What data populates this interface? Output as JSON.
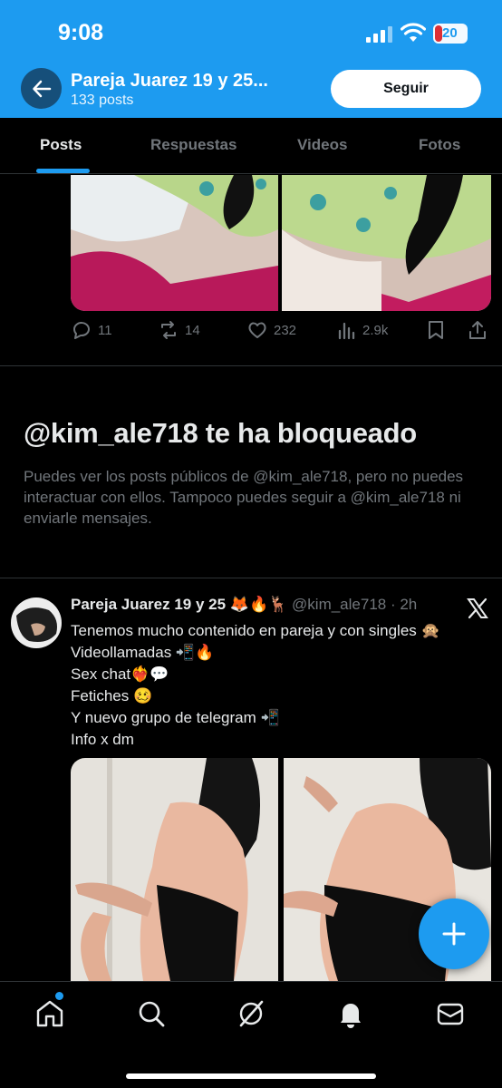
{
  "status_bar": {
    "time": "9:08",
    "battery": "20"
  },
  "header": {
    "profile_name": "Pareja Juarez 19 y 25...",
    "posts_count": "133 posts",
    "follow_label": "Seguir"
  },
  "tabs": [
    {
      "label": "Posts",
      "active": true
    },
    {
      "label": "Respuestas",
      "active": false
    },
    {
      "label": "Videos",
      "active": false
    },
    {
      "label": "Fotos",
      "active": false
    }
  ],
  "previous_post": {
    "replies": "11",
    "reposts": "14",
    "likes": "232",
    "views": "2.9k"
  },
  "blocked": {
    "title": "@kim_ale718 te ha bloqueado",
    "description": "Puedes ver los posts públicos de @kim_ale718, pero no puedes interactuar con ellos. Tampoco puedes seguir a @kim_ale718 ni enviarle mensajes."
  },
  "post": {
    "author": "Pareja Juarez 19 y 25 🦊🔥🦌",
    "handle_time": "@kim_ale718 · 2h",
    "lines": [
      "Tenemos mucho contenido en pareja y con singles 🙊",
      "Videollamadas 📲🔥",
      "Sex chat❤️‍🔥💬",
      "Fetiches 🥴",
      "Y nuevo grupo de telegram 📲",
      "Info x dm"
    ]
  },
  "bottom_nav": [
    {
      "icon": "home-icon"
    },
    {
      "icon": "search-icon"
    },
    {
      "icon": "grok-icon"
    },
    {
      "icon": "bell-icon"
    },
    {
      "icon": "mail-icon"
    }
  ],
  "colors": {
    "accent": "#1d9bf0",
    "background": "#000000",
    "muted": "#71767b",
    "text": "#e7e9ea"
  }
}
